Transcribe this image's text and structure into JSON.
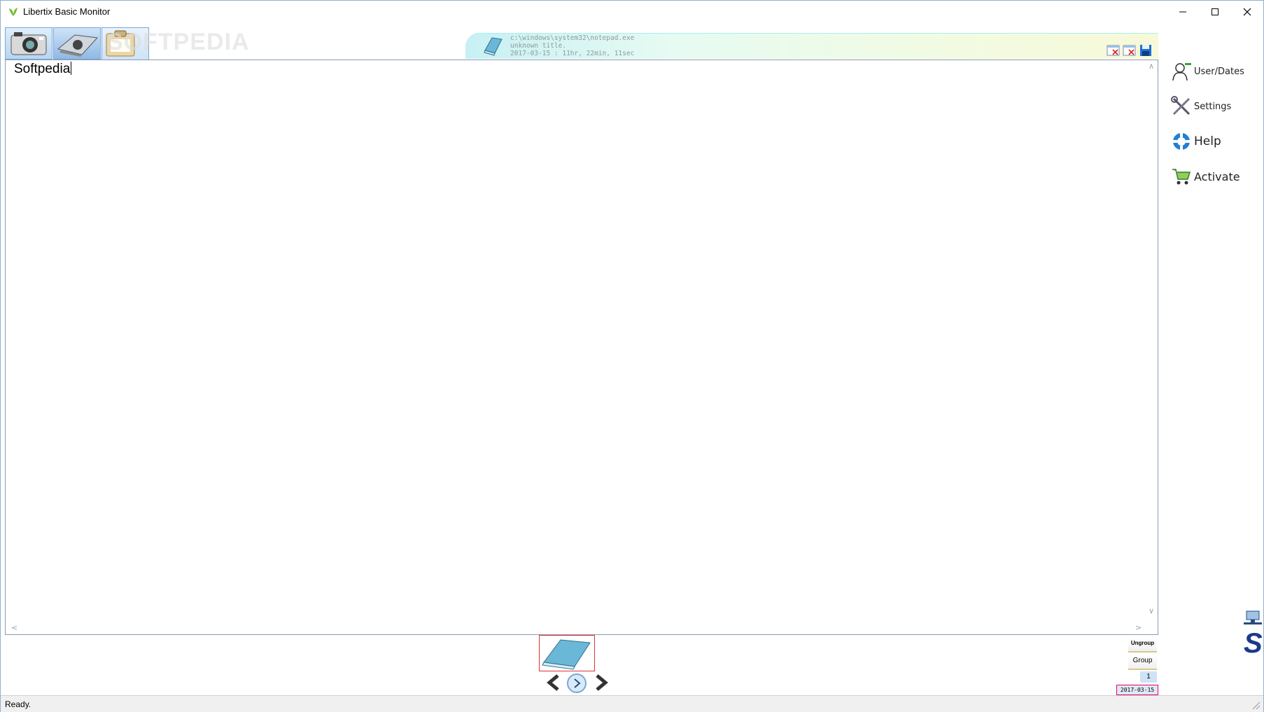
{
  "window": {
    "title": "Libertix Basic Monitor",
    "controls": [
      "minimize-icon",
      "maximize-icon",
      "close-icon"
    ]
  },
  "toolbar": {
    "tabs": [
      {
        "icon": "camera-icon"
      },
      {
        "icon": "keyboard-icon"
      },
      {
        "icon": "clipboard-icon"
      }
    ],
    "watermark": "SOFTPEDIA"
  },
  "banner": {
    "path": "c:\\windows\\system32\\notepad.exe",
    "window_title": "unknown title.",
    "timestamp": "2017-03-15 : 11hr, 22min, 11sec",
    "buttons": [
      "close-window-icon",
      "close-all-icon",
      "save-icon"
    ]
  },
  "content": {
    "text": "Softpedia"
  },
  "sidebar": {
    "items": [
      {
        "label": "User/Dates",
        "icon": "user-icon"
      },
      {
        "label": "Settings",
        "icon": "wrench-screwdriver-icon"
      },
      {
        "label": "Help",
        "icon": "lifebuoy-icon"
      },
      {
        "label": "Activate",
        "icon": "cart-icon"
      }
    ]
  },
  "bottom": {
    "ungroup_label": "Ungroup",
    "group_label": "Group",
    "page_number": "1",
    "date": "2017-03-15"
  },
  "status": {
    "text": "Ready."
  },
  "colors": {
    "accent": "#7aa7d8",
    "thumb_border": "#dd3333",
    "logo_blue": "#1a3a8a"
  }
}
